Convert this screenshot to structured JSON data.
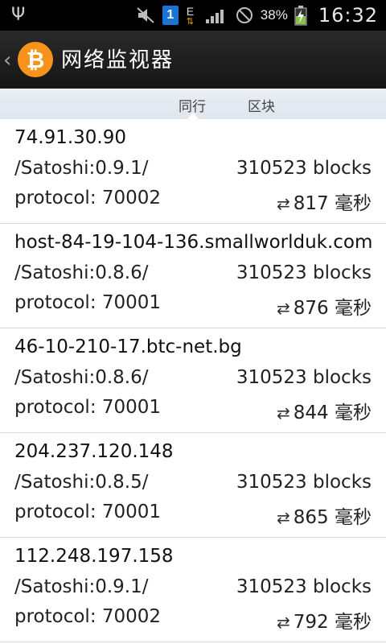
{
  "status_bar": {
    "battery_percent": "38%",
    "time": "16:32",
    "network_letter": "E",
    "notification_count": "1"
  },
  "action_bar": {
    "title": "网络监视器",
    "app_icon_symbol": "₿",
    "back_symbol": "‹",
    "accent_color": "#f7931a"
  },
  "tabs": [
    {
      "label": "同行",
      "active": true
    },
    {
      "label": "区块",
      "active": false
    }
  ],
  "ping_symbol": "⇄",
  "peers": [
    {
      "host": "74.91.30.90",
      "agent": "/Satoshi:0.9.1/",
      "blocks": "310523 blocks",
      "protocol": "protocol: 70002",
      "ping": "817 毫秒"
    },
    {
      "host": "host-84-19-104-136.smallworlduk.com",
      "agent": "/Satoshi:0.8.6/",
      "blocks": "310523 blocks",
      "protocol": "protocol: 70001",
      "ping": "876 毫秒"
    },
    {
      "host": "46-10-210-17.btc-net.bg",
      "agent": "/Satoshi:0.8.6/",
      "blocks": "310523 blocks",
      "protocol": "protocol: 70001",
      "ping": "844 毫秒"
    },
    {
      "host": "204.237.120.148",
      "agent": "/Satoshi:0.8.5/",
      "blocks": "310523 blocks",
      "protocol": "protocol: 70001",
      "ping": "865 毫秒"
    },
    {
      "host": "112.248.197.158",
      "agent": "/Satoshi:0.9.1/",
      "blocks": "310523 blocks",
      "protocol": "protocol: 70002",
      "ping": "792 毫秒"
    }
  ]
}
